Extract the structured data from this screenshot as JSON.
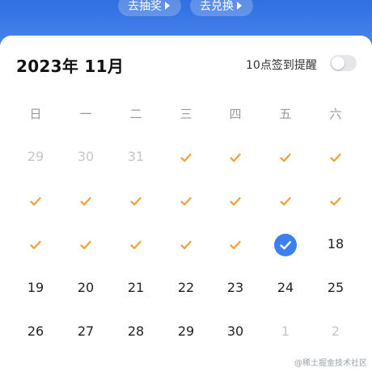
{
  "header": {
    "lottery_label": "去抽奖",
    "redeem_label": "去兑换"
  },
  "calendar": {
    "title": "2023年 11月",
    "reminder_label": "10点签到提醒",
    "reminder_enabled": false,
    "weekdays": [
      "日",
      "一",
      "二",
      "三",
      "四",
      "五",
      "六"
    ],
    "rows": [
      [
        {
          "t": "29",
          "s": "muted"
        },
        {
          "t": "30",
          "s": "muted"
        },
        {
          "t": "31",
          "s": "muted"
        },
        {
          "t": "",
          "s": "checked"
        },
        {
          "t": "",
          "s": "checked"
        },
        {
          "t": "",
          "s": "checked"
        },
        {
          "t": "",
          "s": "checked"
        }
      ],
      [
        {
          "t": "",
          "s": "checked"
        },
        {
          "t": "",
          "s": "checked"
        },
        {
          "t": "",
          "s": "checked"
        },
        {
          "t": "",
          "s": "checked"
        },
        {
          "t": "",
          "s": "checked"
        },
        {
          "t": "",
          "s": "checked"
        },
        {
          "t": "",
          "s": "checked"
        }
      ],
      [
        {
          "t": "",
          "s": "checked"
        },
        {
          "t": "",
          "s": "checked"
        },
        {
          "t": "",
          "s": "checked"
        },
        {
          "t": "",
          "s": "checked"
        },
        {
          "t": "",
          "s": "checked"
        },
        {
          "t": "",
          "s": "today-checked"
        },
        {
          "t": "18",
          "s": "normal"
        }
      ],
      [
        {
          "t": "19",
          "s": "normal"
        },
        {
          "t": "20",
          "s": "normal"
        },
        {
          "t": "21",
          "s": "normal"
        },
        {
          "t": "22",
          "s": "normal"
        },
        {
          "t": "23",
          "s": "normal"
        },
        {
          "t": "24",
          "s": "normal"
        },
        {
          "t": "25",
          "s": "normal"
        }
      ],
      [
        {
          "t": "26",
          "s": "normal"
        },
        {
          "t": "27",
          "s": "normal"
        },
        {
          "t": "28",
          "s": "normal"
        },
        {
          "t": "29",
          "s": "normal"
        },
        {
          "t": "30",
          "s": "normal"
        },
        {
          "t": "1",
          "s": "muted"
        },
        {
          "t": "2",
          "s": "muted"
        }
      ]
    ]
  },
  "colors": {
    "accent": "#3d7ff1",
    "check": "#f0a23c",
    "muted": "#c6c6c6"
  },
  "icons": {
    "check": "checkmark-icon",
    "arrow": "play-arrow-icon"
  },
  "watermark": "@稀土掘金技术社区"
}
